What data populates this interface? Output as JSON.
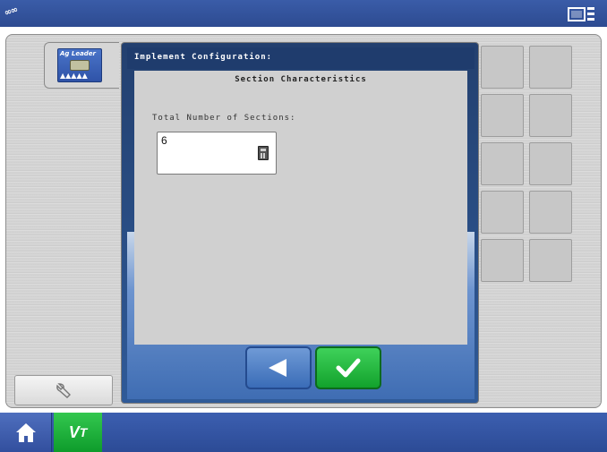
{
  "topbar": {
    "left_logo": "∞∞",
    "right_icon": "display-settings-icon"
  },
  "sidebar": {
    "module_label": "Ag Leader",
    "module_icon": "ag-leader-module-icon",
    "wrench_icon": "wrench-icon"
  },
  "dialog": {
    "title": "Implement Configuration:",
    "heading": "Section Characteristics",
    "field_label": "Total Number of Sections:",
    "field_value": "6",
    "calc_icon": "calculator-icon",
    "back_icon": "back-arrow-icon",
    "ok_icon": "checkmark-icon"
  },
  "right_grid": {
    "tiles": 10
  },
  "bottombar": {
    "home_icon": "home-icon",
    "vt_label": "V",
    "vt_sub": "T"
  },
  "colors": {
    "topbar_blue": "#2d4b91",
    "accent_green": "#12a22c",
    "dialog_blue": "#2f5a98"
  }
}
